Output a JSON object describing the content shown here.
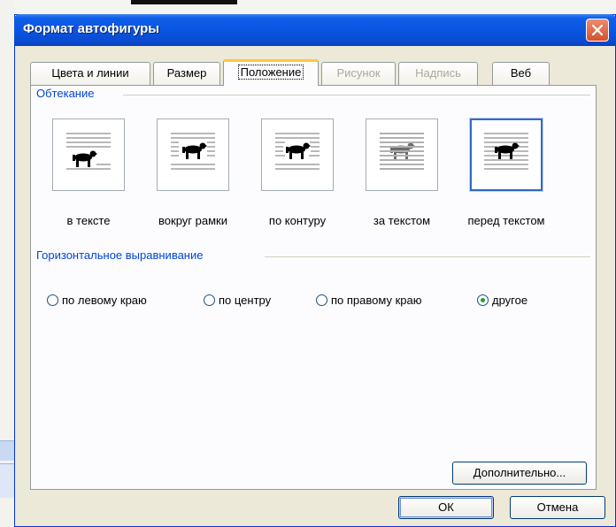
{
  "dialog": {
    "title": "Формат автофигуры",
    "close_icon": "close-icon"
  },
  "tabs": [
    {
      "label": "Цвета и линии",
      "state": "normal"
    },
    {
      "label": "Размер",
      "state": "normal"
    },
    {
      "label": "Положение",
      "state": "active"
    },
    {
      "label": "Рисунок",
      "state": "disabled"
    },
    {
      "label": "Надпись",
      "state": "disabled"
    },
    {
      "label": "Веб",
      "state": "normal"
    }
  ],
  "wrapping": {
    "group_label": "Обтекание",
    "options": [
      {
        "label": "в тексте",
        "icon": "wrap-inline-icon",
        "selected": false
      },
      {
        "label": "вокруг рамки",
        "icon": "wrap-square-icon",
        "selected": false
      },
      {
        "label": "по контуру",
        "icon": "wrap-tight-icon",
        "selected": false
      },
      {
        "label": "за текстом",
        "icon": "wrap-behind-text-icon",
        "selected": false
      },
      {
        "label": "перед текстом",
        "icon": "wrap-in-front-icon",
        "selected": true
      }
    ]
  },
  "horizontal_alignment": {
    "group_label": "Горизонтальное выравнивание",
    "options": [
      {
        "label": "по левому краю",
        "checked": false
      },
      {
        "label": "по центру",
        "checked": false
      },
      {
        "label": "по правому краю",
        "checked": false
      },
      {
        "label": "другое",
        "checked": true
      }
    ]
  },
  "buttons": {
    "advanced": "Дополнительно...",
    "ok": "ОК",
    "cancel": "Отмена"
  },
  "colors": {
    "titlebar": "#0a54e0",
    "group_label": "#0046d5",
    "dialog_face": "#ece9d8",
    "selected_border": "#316ac5"
  }
}
